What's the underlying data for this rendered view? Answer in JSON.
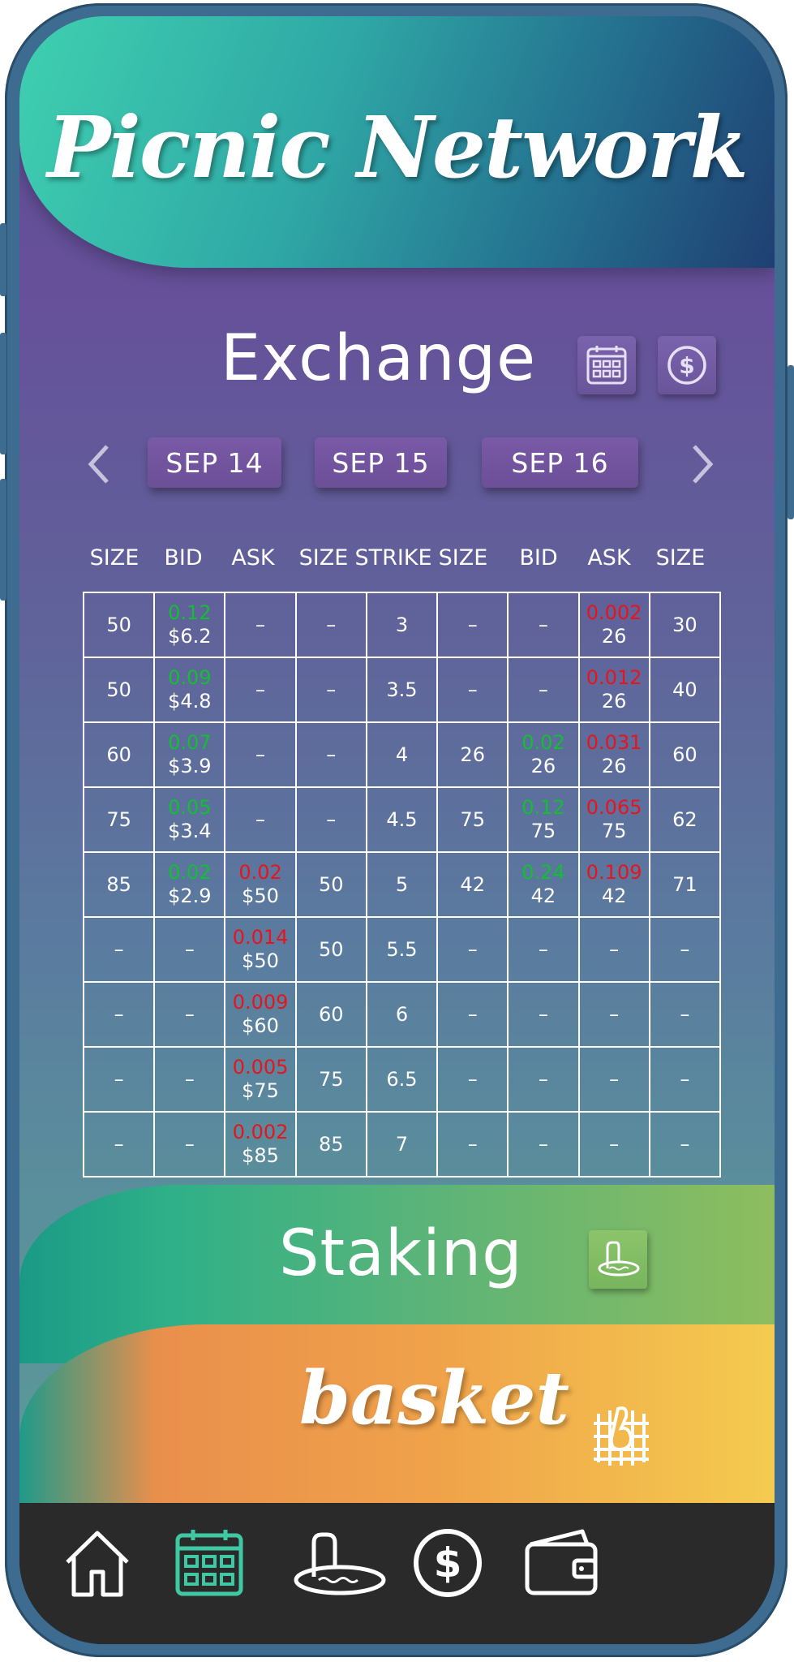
{
  "app": {
    "title": "Picnic Network"
  },
  "exchange": {
    "title": "Exchange",
    "dates": [
      "SEP 14",
      "SEP 15",
      "SEP 16"
    ],
    "columns": [
      "SIZE",
      "BID",
      "ASK",
      "SIZE",
      "STRIKE",
      "SIZE",
      "BID",
      "ASK",
      "SIZE"
    ],
    "rows": [
      [
        [
          "50"
        ],
        [
          "0.12",
          "$6.2"
        ],
        [
          "–"
        ],
        [
          "–"
        ],
        [
          "3"
        ],
        [
          "–"
        ],
        [
          "–"
        ],
        [
          "0.002",
          "26"
        ],
        [
          "30"
        ]
      ],
      [
        [
          "50"
        ],
        [
          "0.09",
          "$4.8"
        ],
        [
          "–"
        ],
        [
          "–"
        ],
        [
          "3.5"
        ],
        [
          "–"
        ],
        [
          "–"
        ],
        [
          "0.012",
          "26"
        ],
        [
          "40"
        ]
      ],
      [
        [
          "60"
        ],
        [
          "0.07",
          "$3.9"
        ],
        [
          "–"
        ],
        [
          "–"
        ],
        [
          "4"
        ],
        [
          "26"
        ],
        [
          "0.02",
          "26"
        ],
        [
          "0.031",
          "26"
        ],
        [
          "60"
        ]
      ],
      [
        [
          "75"
        ],
        [
          "0.05",
          "$3.4"
        ],
        [
          "–"
        ],
        [
          "–"
        ],
        [
          "4.5"
        ],
        [
          "75"
        ],
        [
          "0.12",
          "75"
        ],
        [
          "0.065",
          "75"
        ],
        [
          "62"
        ]
      ],
      [
        [
          "85"
        ],
        [
          "0.02",
          "$2.9"
        ],
        [
          "0.02",
          "$50"
        ],
        [
          "50"
        ],
        [
          "5"
        ],
        [
          "42"
        ],
        [
          "0.24",
          "42"
        ],
        [
          "0.109",
          "42"
        ],
        [
          "71"
        ]
      ],
      [
        [
          "–"
        ],
        [
          "–"
        ],
        [
          "0.014",
          "$50"
        ],
        [
          "50"
        ],
        [
          "5.5"
        ],
        [
          "–"
        ],
        [
          "–"
        ],
        [
          "–"
        ],
        [
          "–"
        ]
      ],
      [
        [
          "–"
        ],
        [
          "–"
        ],
        [
          "0.009",
          "$60"
        ],
        [
          "60"
        ],
        [
          "6"
        ],
        [
          "–"
        ],
        [
          "–"
        ],
        [
          "–"
        ],
        [
          "–"
        ]
      ],
      [
        [
          "–"
        ],
        [
          "–"
        ],
        [
          "0.005",
          "$75"
        ],
        [
          "75"
        ],
        [
          "6.5"
        ],
        [
          "–"
        ],
        [
          "–"
        ],
        [
          "–"
        ],
        [
          "–"
        ]
      ],
      [
        [
          "–"
        ],
        [
          "–"
        ],
        [
          "0.002",
          "$85"
        ],
        [
          "85"
        ],
        [
          "7"
        ],
        [
          "–"
        ],
        [
          "–"
        ],
        [
          "–"
        ],
        [
          "–"
        ]
      ]
    ],
    "colors": {
      "bid": "#10c030",
      "ask": "#e8141c"
    }
  },
  "staking": {
    "title": "Staking"
  },
  "basket": {
    "title": "basket"
  },
  "bottom_nav": [
    "home-icon",
    "calendar-icon",
    "staking-icon",
    "dollar-icon",
    "wallet-icon"
  ]
}
